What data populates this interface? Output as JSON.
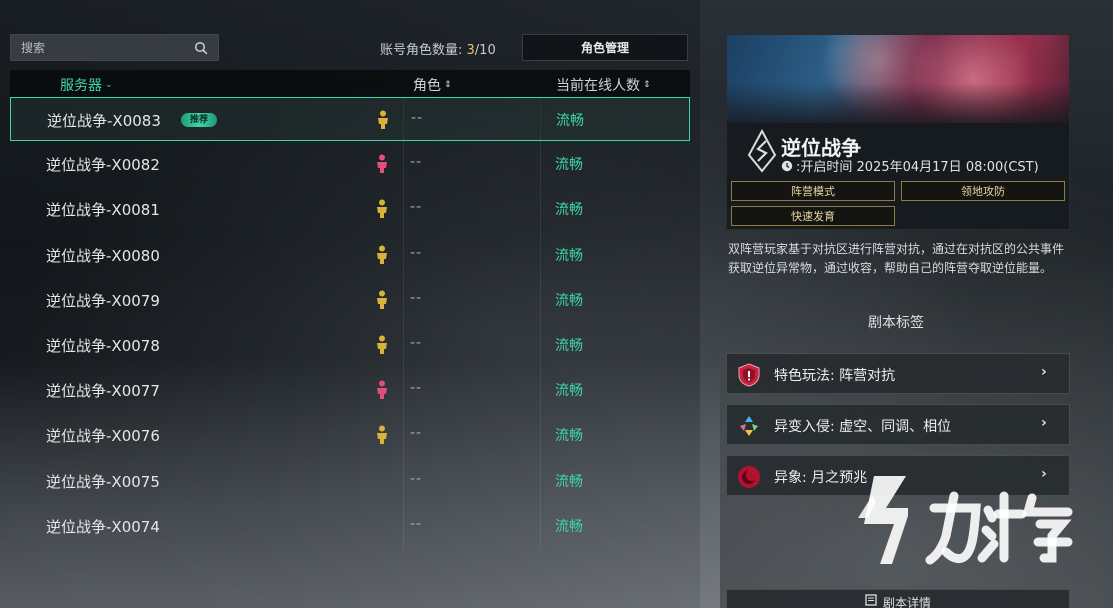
{
  "search": {
    "label": "搜索",
    "icon": "search-icon"
  },
  "account": {
    "label": "账号角色数量: ",
    "current": "3",
    "max": "/10"
  },
  "role_manage_label": "角色管理",
  "table": {
    "headers": {
      "server": "服务器",
      "role": "角色",
      "online": "当前在线人数"
    },
    "sort_glyph": "⇕",
    "rows": [
      {
        "name": "逆位战争-X0083",
        "badge": "推荐",
        "char": "yellow",
        "role": "--",
        "status": "流畅",
        "selected": true
      },
      {
        "name": "逆位战争-X0082",
        "char": "pink",
        "role": "--",
        "status": "流畅"
      },
      {
        "name": "逆位战争-X0081",
        "char": "yellow",
        "role": "--",
        "status": "流畅"
      },
      {
        "name": "逆位战争-X0080",
        "char": "yellow",
        "role": "--",
        "status": "流畅"
      },
      {
        "name": "逆位战争-X0079",
        "char": "yellow",
        "role": "--",
        "status": "流畅"
      },
      {
        "name": "逆位战争-X0078",
        "char": "yellow",
        "role": "--",
        "status": "流畅"
      },
      {
        "name": "逆位战争-X0077",
        "char": "pink",
        "role": "--",
        "status": "流畅"
      },
      {
        "name": "逆位战争-X0076",
        "char": "yellow",
        "role": "--",
        "status": "流畅"
      },
      {
        "name": "逆位战争-X0075",
        "char": "none",
        "role": "--",
        "status": "流畅"
      },
      {
        "name": "逆位战争-X0074",
        "char": "none",
        "role": "--",
        "status": "流畅"
      }
    ]
  },
  "colors": {
    "accent": "#3fd6a6",
    "char_yellow": "#d9b23a",
    "char_pink": "#e0507a",
    "tag_border": "#8d7a44"
  },
  "mode": {
    "title": "逆位战争",
    "open_time": ":开启时间 2025年04月17日 08:00(CST)",
    "tags": [
      "阵营模式",
      "领地攻防",
      "快速发育"
    ],
    "description": "双阵营玩家基于对抗区进行阵营对抗，通过在对抗区的公共事件获取逆位异常物，通过收容，帮助自己的阵营夺取逆位能量。"
  },
  "script_tags_title": "剧本标签",
  "features": [
    {
      "label": "特色玩法: 阵营对抗",
      "icon": "shield-icon"
    },
    {
      "label": "异变入侵: 虚空、同调、相位",
      "icon": "triad-icon"
    },
    {
      "label": "异象: 月之预兆",
      "icon": "moon-icon"
    }
  ],
  "detail_label": "剧本详情",
  "watermark": {
    "text": "九游"
  }
}
